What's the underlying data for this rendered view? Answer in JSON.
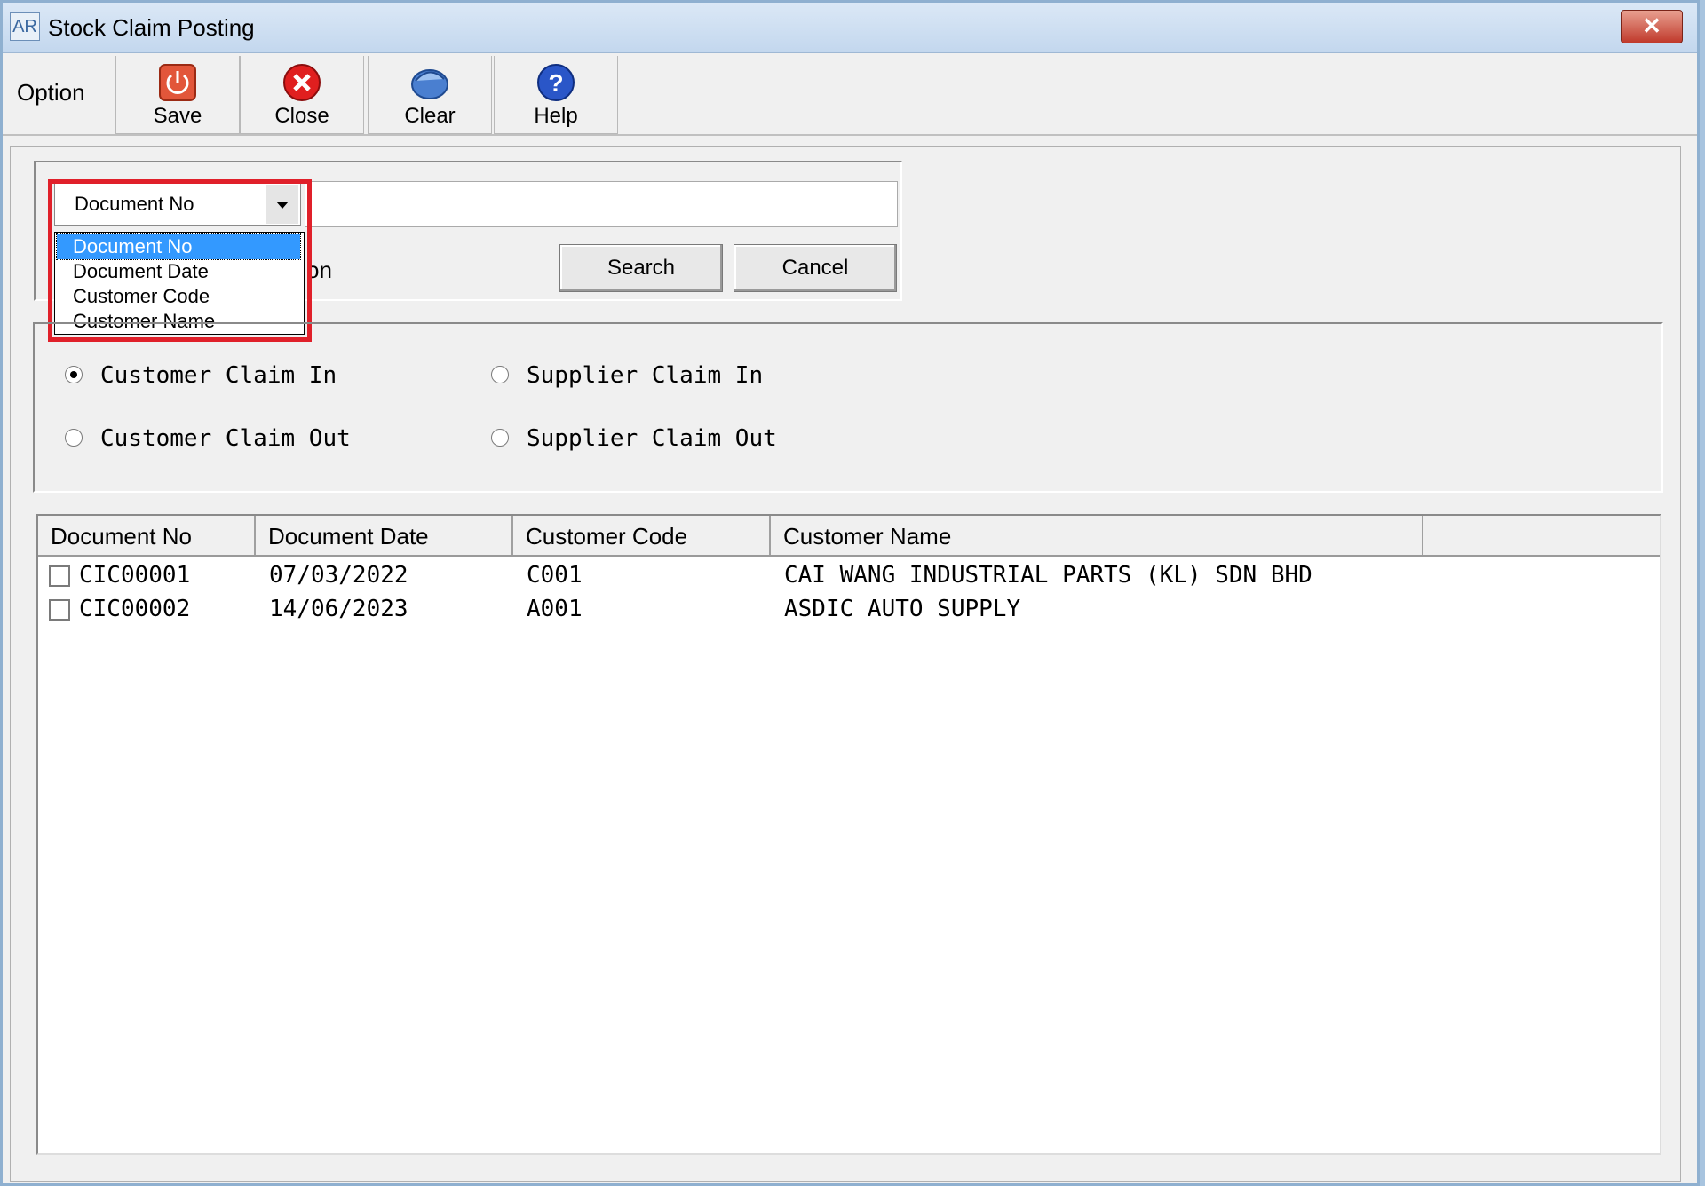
{
  "window": {
    "title": "Stock Claim Posting",
    "app_icon_text": "AR",
    "close_glyph": "✕"
  },
  "toolbar": {
    "option_label": "Option",
    "buttons": [
      {
        "label": "Save",
        "icon": "power-icon",
        "color": "#d9442a"
      },
      {
        "label": "Close",
        "icon": "close-circle-icon",
        "color": "#e01f1f"
      },
      {
        "label": "Clear",
        "icon": "clear-icon",
        "color": "#3a6fc0"
      },
      {
        "label": "Help",
        "icon": "help-icon",
        "color": "#2a56c8"
      }
    ]
  },
  "search": {
    "field_selected": "Document No",
    "field_options": [
      "Document No",
      "Document Date",
      "Customer Code",
      "Customer Name"
    ],
    "partial_label": "on",
    "search_button": "Search",
    "cancel_button": "Cancel"
  },
  "claim_types": [
    {
      "label": "Customer Claim In",
      "selected": true
    },
    {
      "label": "Supplier Claim In",
      "selected": false
    },
    {
      "label": "Customer Claim Out",
      "selected": false
    },
    {
      "label": "Supplier Claim Out",
      "selected": false
    }
  ],
  "grid": {
    "columns": [
      "Document No",
      "Document Date",
      "Customer Code",
      "Customer Name"
    ],
    "rows": [
      {
        "doc_no": "CIC00001",
        "date": "07/03/2022",
        "code": "C001",
        "name": "CAI WANG INDUSTRIAL PARTS (KL) SDN BHD"
      },
      {
        "doc_no": "CIC00002",
        "date": "14/06/2023",
        "code": "A001",
        "name": "ASDIC AUTO SUPPLY"
      }
    ]
  },
  "colors": {
    "highlight": "#e0202a",
    "selection": "#3399ff"
  }
}
